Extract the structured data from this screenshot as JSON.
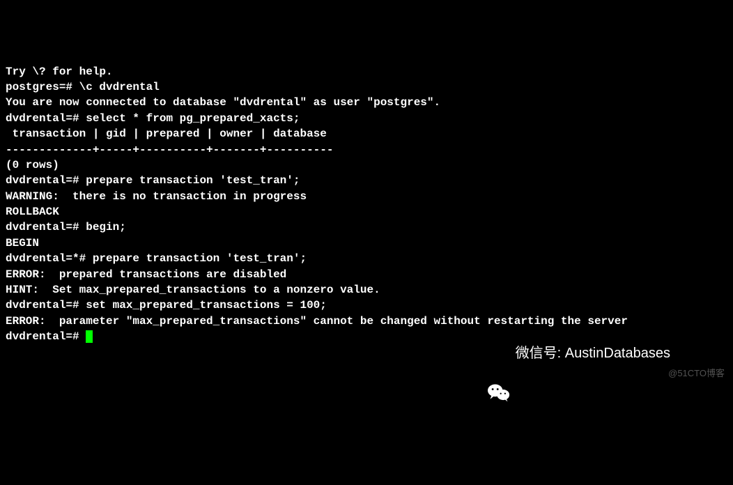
{
  "terminal": {
    "lines": [
      "Try \\? for help.",
      "postgres=# \\c dvdrental",
      "You are now connected to database \"dvdrental\" as user \"postgres\".",
      "dvdrental=# select * from pg_prepared_xacts;",
      " transaction | gid | prepared | owner | database ",
      "-------------+-----+----------+-------+----------",
      "(0 rows)",
      "",
      "dvdrental=# prepare transaction 'test_tran';",
      "WARNING:  there is no transaction in progress",
      "ROLLBACK",
      "dvdrental=# begin;",
      "BEGIN",
      "dvdrental=*# prepare transaction 'test_tran';",
      "ERROR:  prepared transactions are disabled",
      "HINT:  Set max_prepared_transactions to a nonzero value.",
      "dvdrental=# set max_prepared_transactions = 100;",
      "ERROR:  parameter \"max_prepared_transactions\" cannot be changed without restarting the server",
      "dvdrental=# "
    ]
  },
  "overlay": {
    "wechat_label": "微信号: AustinDatabases",
    "watermark": "@51CTO博客"
  }
}
